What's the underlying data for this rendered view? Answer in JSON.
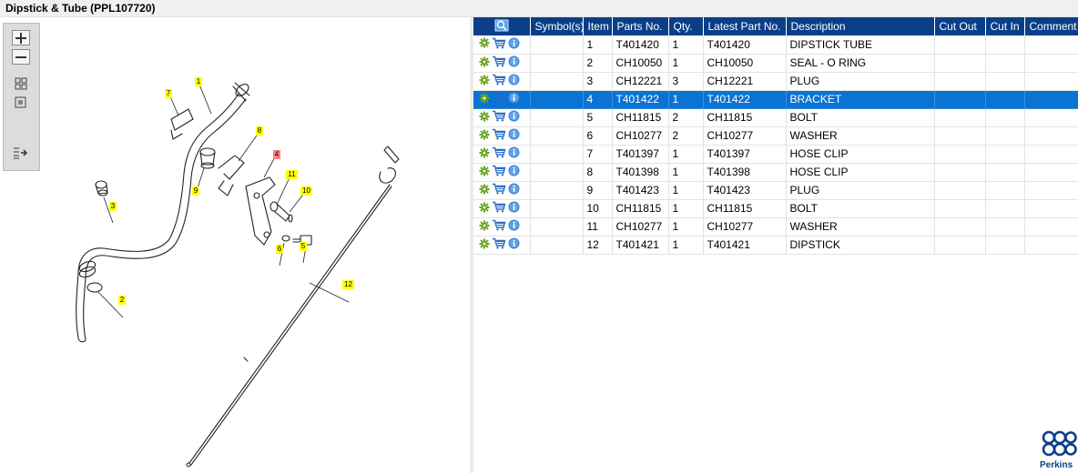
{
  "window": {
    "title": "Dipstick & Tube (PPL107720)"
  },
  "zoom_controls": [
    "zoom-in",
    "zoom-out",
    "fit-all",
    "fit-page",
    "show-list"
  ],
  "diagram": {
    "callouts": [
      {
        "label": "1",
        "highlight": false
      },
      {
        "label": "2",
        "highlight": false
      },
      {
        "label": "3",
        "highlight": false
      },
      {
        "label": "4",
        "highlight": true
      },
      {
        "label": "5",
        "highlight": false
      },
      {
        "label": "6",
        "highlight": false
      },
      {
        "label": "7",
        "highlight": false
      },
      {
        "label": "8",
        "highlight": false
      },
      {
        "label": "9",
        "highlight": false
      },
      {
        "label": "10",
        "highlight": false
      },
      {
        "label": "11",
        "highlight": false
      },
      {
        "label": "12",
        "highlight": false
      }
    ],
    "colors": {
      "callout_fill": "#ffff00",
      "callout_highlight": "#ff8080"
    }
  },
  "table": {
    "headers": {
      "icons": "",
      "symbols": "Symbol(s)",
      "item": "Item",
      "part_no": "Parts No.",
      "qty": "Qty.",
      "latest": "Latest Part No.",
      "description": "Description",
      "cut_out": "Cut Out",
      "cut_in": "Cut In",
      "comment": "Comment"
    },
    "rows": [
      {
        "item": "1",
        "part_no": "T401420",
        "qty": "1",
        "latest": "T401420",
        "description": "DIPSTICK TUBE",
        "selected": false
      },
      {
        "item": "2",
        "part_no": "CH10050",
        "qty": "1",
        "latest": "CH10050",
        "description": "SEAL - O RING",
        "selected": false
      },
      {
        "item": "3",
        "part_no": "CH12221",
        "qty": "3",
        "latest": "CH12221",
        "description": "PLUG",
        "selected": false
      },
      {
        "item": "4",
        "part_no": "T401422",
        "qty": "1",
        "latest": "T401422",
        "description": "BRACKET",
        "selected": true
      },
      {
        "item": "5",
        "part_no": "CH11815",
        "qty": "2",
        "latest": "CH11815",
        "description": "BOLT",
        "selected": false
      },
      {
        "item": "6",
        "part_no": "CH10277",
        "qty": "2",
        "latest": "CH10277",
        "description": "WASHER",
        "selected": false
      },
      {
        "item": "7",
        "part_no": "T401397",
        "qty": "1",
        "latest": "T401397",
        "description": "HOSE CLIP",
        "selected": false
      },
      {
        "item": "8",
        "part_no": "T401398",
        "qty": "1",
        "latest": "T401398",
        "description": "HOSE CLIP",
        "selected": false
      },
      {
        "item": "9",
        "part_no": "T401423",
        "qty": "1",
        "latest": "T401423",
        "description": "PLUG",
        "selected": false
      },
      {
        "item": "10",
        "part_no": "CH11815",
        "qty": "1",
        "latest": "CH11815",
        "description": "BOLT",
        "selected": false
      },
      {
        "item": "11",
        "part_no": "CH10277",
        "qty": "1",
        "latest": "CH10277",
        "description": "WASHER",
        "selected": false
      },
      {
        "item": "12",
        "part_no": "T401421",
        "qty": "1",
        "latest": "T401421",
        "description": "DIPSTICK",
        "selected": false
      }
    ],
    "row_icons": [
      "gear-icon",
      "cart-icon",
      "info-icon"
    ]
  },
  "brand": {
    "name": "Perkins",
    "color": "#0a3f88"
  },
  "colors": {
    "header": "#0a3f88",
    "selected_row": "#0a73d4",
    "gear": "#6aa321"
  }
}
